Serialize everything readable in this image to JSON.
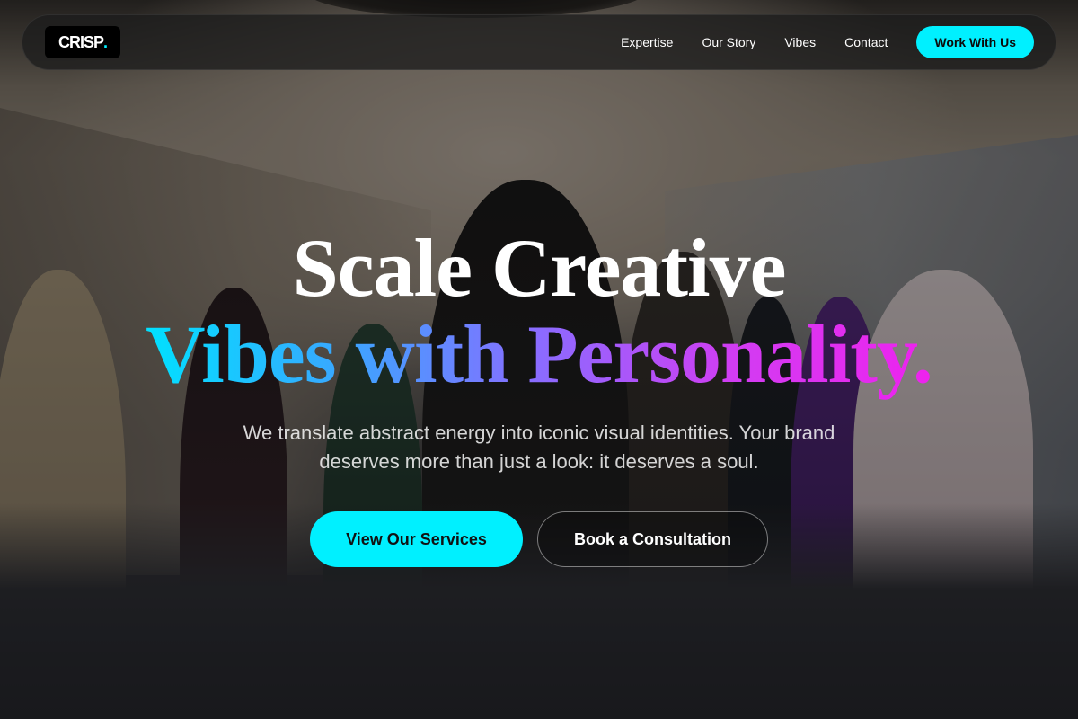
{
  "brand": {
    "name": "CRISP",
    "dot": ".",
    "accent": "#00f0ff"
  },
  "nav": {
    "links": [
      "Expertise",
      "Our Story",
      "Vibes",
      "Contact"
    ],
    "cta_label": "Work With Us"
  },
  "hero": {
    "headline_line1": "Scale Creative",
    "headline_line2": "Vibes with Personality.",
    "gradient_colors": [
      "#00e1ff",
      "#3aa6ff",
      "#8b6bff",
      "#d23cf2",
      "#ee22ee"
    ],
    "subtext": "We translate abstract energy into iconic visual identities. Your brand deserves more than just a look: it deserves a soul.",
    "primary_button": "View Our Services",
    "secondary_button": "Book a Consultation"
  }
}
